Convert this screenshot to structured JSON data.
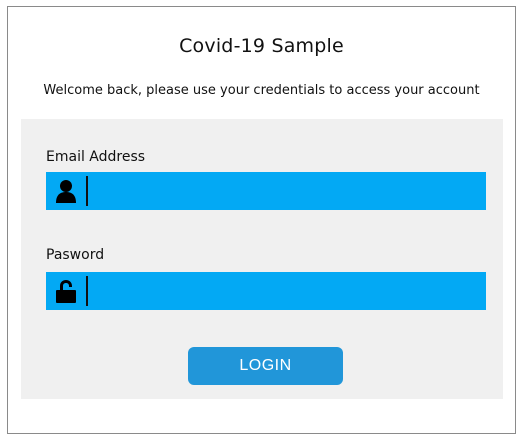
{
  "header": {
    "title": "Covid-19 Sample",
    "subtitle": "Welcome back, please use your credentials to access your account"
  },
  "form": {
    "email_label": "Email Address",
    "email_value": "",
    "email_icon": "user-icon",
    "password_label": "Pasword",
    "password_value": "",
    "password_icon": "unlock-icon",
    "login_label": "LOGIN"
  },
  "colors": {
    "field_bg": "#03a9f4",
    "button_bg": "#2196d9",
    "panel_bg": "#f0f0f0"
  }
}
